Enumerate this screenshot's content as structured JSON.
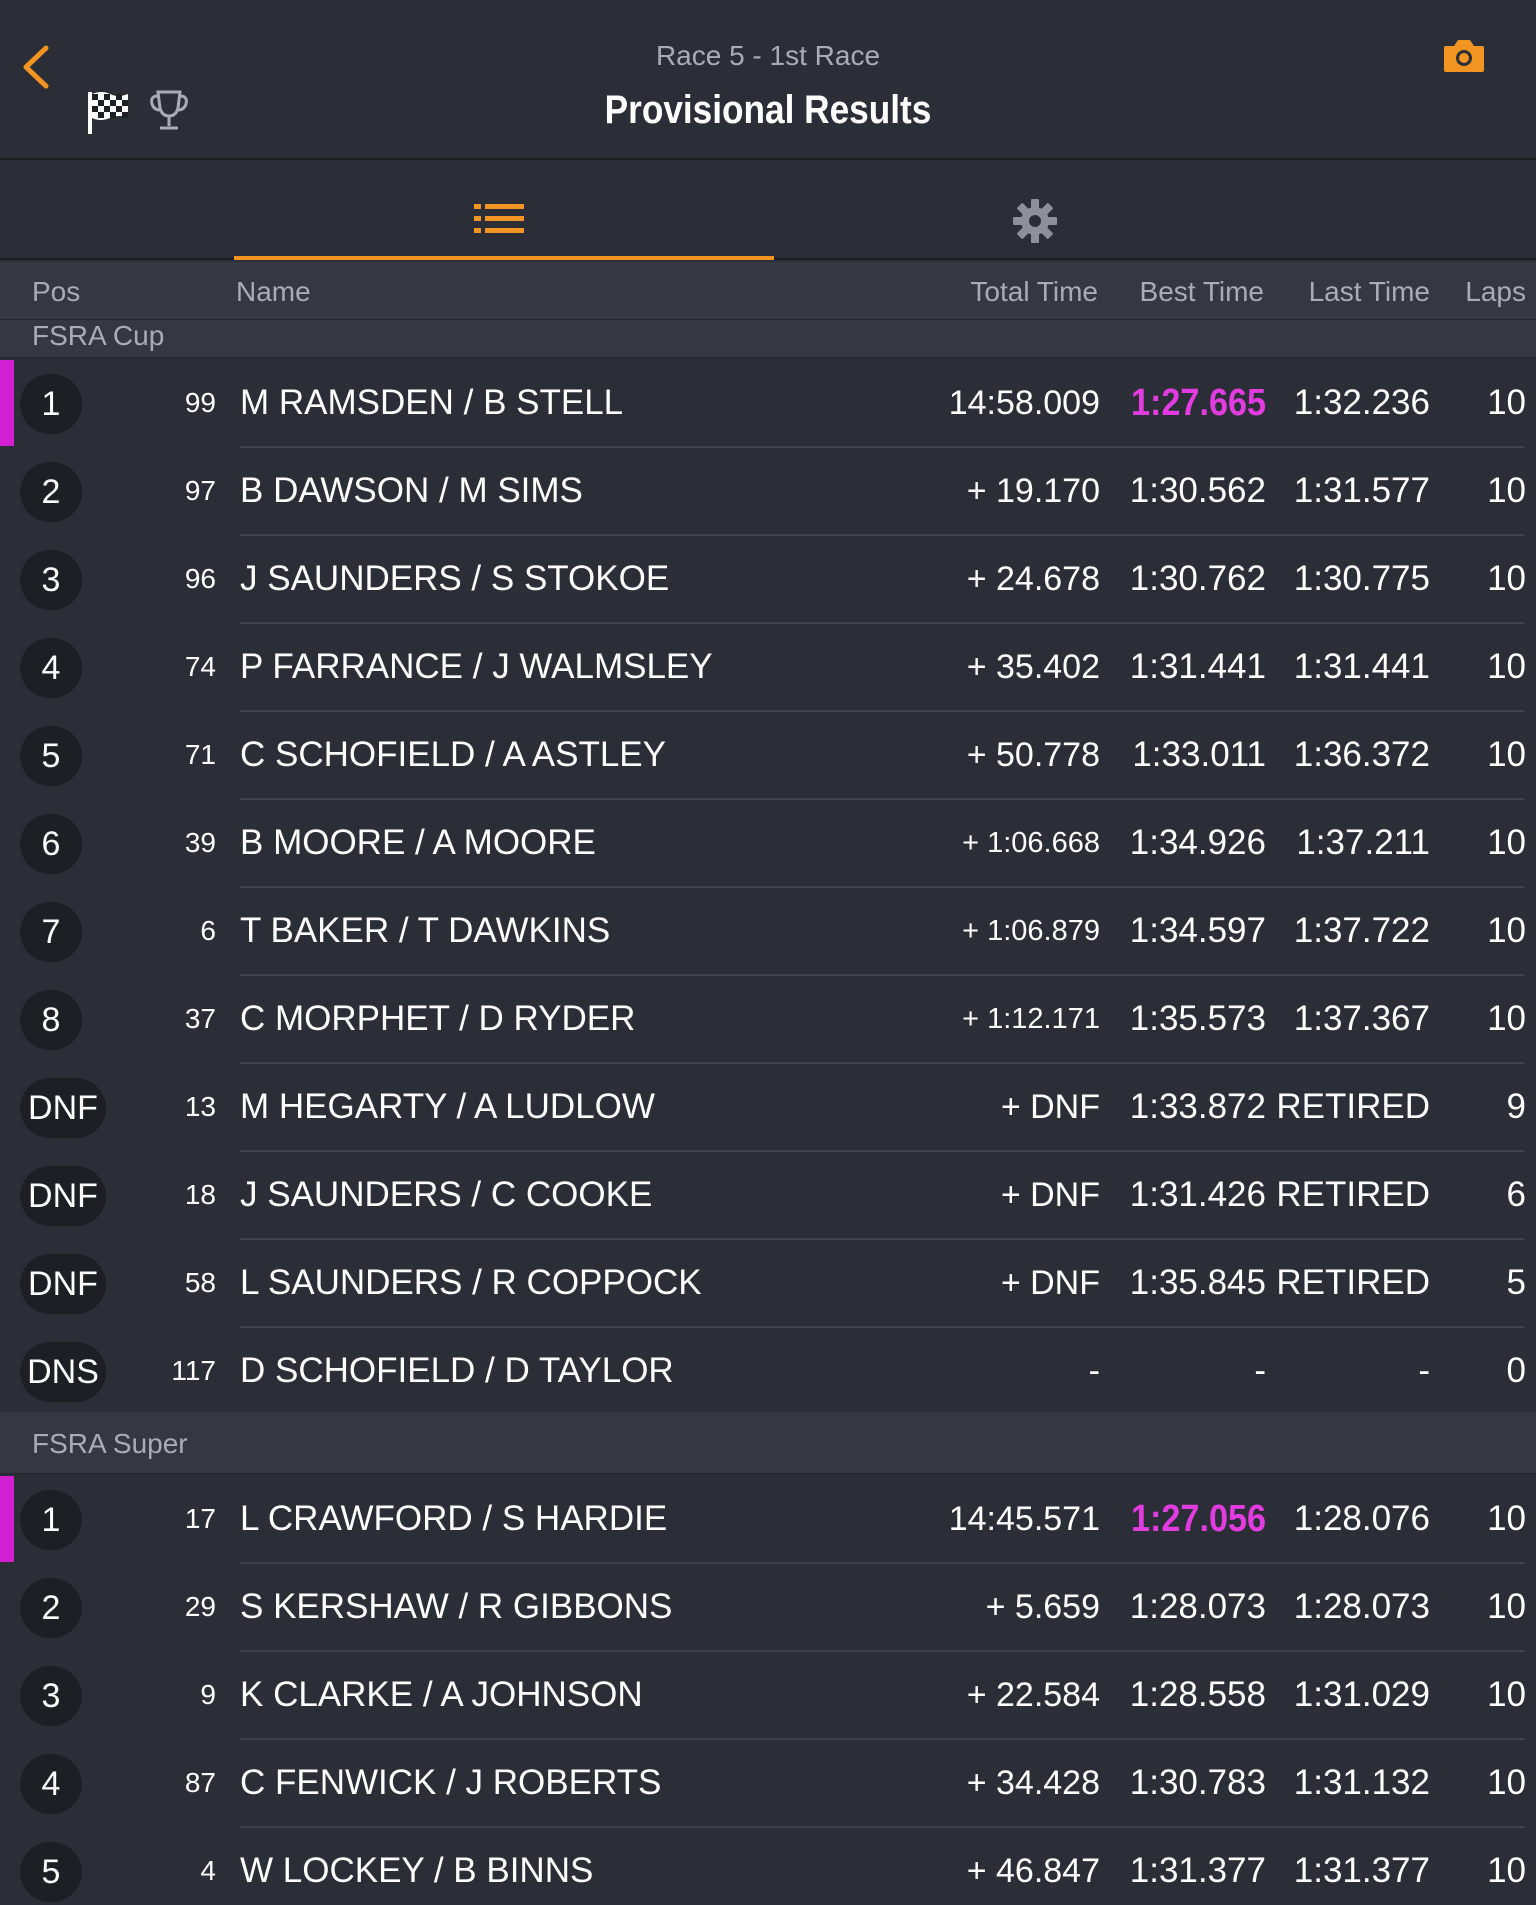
{
  "header": {
    "subtitle": "Race 5 - 1st Race",
    "title": "Provisional Results",
    "accent": "#f29522"
  },
  "tabs": [
    {
      "name": "results-list",
      "icon": "list-icon",
      "active": true
    },
    {
      "name": "settings",
      "icon": "gear-icon",
      "active": false
    }
  ],
  "columns": {
    "pos": "Pos",
    "name": "Name",
    "total": "Total Time",
    "best": "Best Time",
    "last": "Last Time",
    "laps": "Laps"
  },
  "sections": [
    {
      "title": "FSRA Cup",
      "rows": [
        {
          "pos": "1",
          "num": "99",
          "name": "M RAMSDEN / B STELL",
          "total": "14:58.009",
          "best": "1:27.665",
          "last": "1:32.236",
          "laps": "10",
          "fastest": true
        },
        {
          "pos": "2",
          "num": "97",
          "name": "B DAWSON / M SIMS",
          "total": "+ 19.170",
          "best": "1:30.562",
          "last": "1:31.577",
          "laps": "10"
        },
        {
          "pos": "3",
          "num": "96",
          "name": "J SAUNDERS / S STOKOE",
          "total": "+ 24.678",
          "best": "1:30.762",
          "last": "1:30.775",
          "laps": "10"
        },
        {
          "pos": "4",
          "num": "74",
          "name": "P FARRANCE / J WALMSLEY",
          "total": "+ 35.402",
          "best": "1:31.441",
          "last": "1:31.441",
          "laps": "10"
        },
        {
          "pos": "5",
          "num": "71",
          "name": "C SCHOFIELD / A ASTLEY",
          "total": "+ 50.778",
          "best": "1:33.011",
          "last": "1:36.372",
          "laps": "10"
        },
        {
          "pos": "6",
          "num": "39",
          "name": "B MOORE / A MOORE",
          "total": "+ 1:06.668",
          "best": "1:34.926",
          "last": "1:37.211",
          "laps": "10"
        },
        {
          "pos": "7",
          "num": "6",
          "name": "T BAKER / T DAWKINS",
          "total": "+ 1:06.879",
          "best": "1:34.597",
          "last": "1:37.722",
          "laps": "10"
        },
        {
          "pos": "8",
          "num": "37",
          "name": "C MORPHET / D RYDER",
          "total": "+ 1:12.171",
          "best": "1:35.573",
          "last": "1:37.367",
          "laps": "10"
        },
        {
          "pos": "DNF",
          "num": "13",
          "name": "M HEGARTY / A LUDLOW",
          "total": "+ DNF",
          "best": "1:33.872",
          "last": "RETIRED",
          "laps": "9"
        },
        {
          "pos": "DNF",
          "num": "18",
          "name": "J SAUNDERS / C COOKE",
          "total": "+ DNF",
          "best": "1:31.426",
          "last": "RETIRED",
          "laps": "6"
        },
        {
          "pos": "DNF",
          "num": "58",
          "name": "L SAUNDERS / R COPPOCK",
          "total": "+ DNF",
          "best": "1:35.845",
          "last": "RETIRED",
          "laps": "5"
        },
        {
          "pos": "DNS",
          "num": "117",
          "name": "D SCHOFIELD / D TAYLOR",
          "total": "-",
          "best": "-",
          "last": "-",
          "laps": "0"
        }
      ]
    },
    {
      "title": "FSRA Super",
      "rows": [
        {
          "pos": "1",
          "num": "17",
          "name": "L CRAWFORD / S HARDIE",
          "total": "14:45.571",
          "best": "1:27.056",
          "last": "1:28.076",
          "laps": "10",
          "fastest": true
        },
        {
          "pos": "2",
          "num": "29",
          "name": "S KERSHAW / R GIBBONS",
          "total": "+ 5.659",
          "best": "1:28.073",
          "last": "1:28.073",
          "laps": "10"
        },
        {
          "pos": "3",
          "num": "9",
          "name": "K CLARKE / A JOHNSON",
          "total": "+ 22.584",
          "best": "1:28.558",
          "last": "1:31.029",
          "laps": "10"
        },
        {
          "pos": "4",
          "num": "87",
          "name": "C FENWICK / J ROBERTS",
          "total": "+ 34.428",
          "best": "1:30.783",
          "last": "1:31.132",
          "laps": "10"
        },
        {
          "pos": "5",
          "num": "4",
          "name": "W LOCKEY / B BINNS",
          "total": "+ 46.847",
          "best": "1:31.377",
          "last": "1:31.377",
          "laps": "10"
        }
      ]
    }
  ]
}
